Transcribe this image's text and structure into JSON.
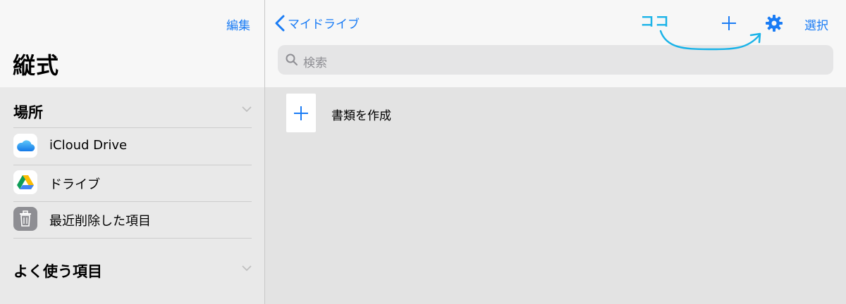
{
  "sidebar": {
    "edit_label": "編集",
    "title": "縦式",
    "locations": {
      "header": "場所",
      "items": [
        {
          "label": "iCloud Drive",
          "icon": "icloud-icon"
        },
        {
          "label": "ドライブ",
          "icon": "google-drive-icon"
        },
        {
          "label": "最近削除した項目",
          "icon": "trash-icon"
        }
      ]
    },
    "favorites": {
      "header": "よく使う項目"
    }
  },
  "main": {
    "back_label": "マイドライブ",
    "select_label": "選択",
    "search": {
      "placeholder": "検索"
    },
    "create_document_label": "書類を作成"
  },
  "annotation": {
    "text": "ココ"
  },
  "colors": {
    "accent": "#1a7cf5",
    "annotation": "#1ab3e8"
  }
}
